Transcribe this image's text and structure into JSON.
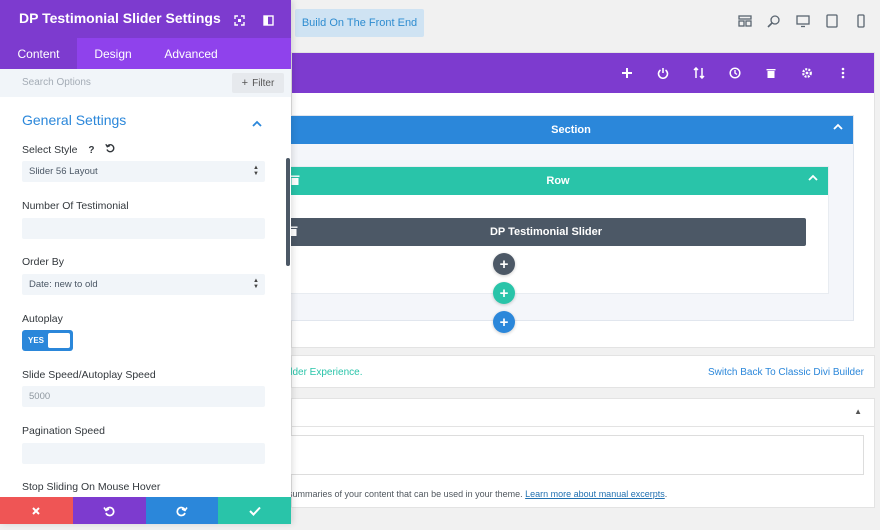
{
  "panel": {
    "title": "DP Testimonial Slider Settings",
    "tabs": [
      "Content",
      "Design",
      "Advanced"
    ],
    "search_placeholder": "Search Options",
    "filter_label": "Filter",
    "group_title": "General Settings",
    "fields": {
      "select_style": {
        "label": "Select Style",
        "value": "Slider 56 Layout"
      },
      "number_of_testimonial": {
        "label": "Number Of Testimonial",
        "value": ""
      },
      "order_by": {
        "label": "Order By",
        "value": "Date: new to old"
      },
      "autoplay": {
        "label": "Autoplay",
        "toggle_text": "YES"
      },
      "slide_speed": {
        "label": "Slide Speed/Autoplay Speed",
        "value": "5000"
      },
      "pagination_speed": {
        "label": "Pagination Speed",
        "value": ""
      },
      "stop_sliding": {
        "label": "Stop Sliding On Mouse Hover"
      }
    },
    "help_icon": "question-icon",
    "reset_icon": "reset-icon"
  },
  "topbar": {
    "front_end_button": "Build On The Front End",
    "view_icons": [
      "wireframe-icon",
      "zoom-icon",
      "desktop-icon",
      "tablet-icon",
      "phone-icon"
    ]
  },
  "builder": {
    "section_label": "Section",
    "row_label": "Row",
    "module_label": "DP Testimonial Slider"
  },
  "info": {
    "left_text": "ilder Experience.",
    "right_link": "Switch Back To Classic Divi Builder"
  },
  "excerpt": {
    "note_text": "summaries of your content that can be used in your theme.",
    "note_link": "Learn more about manual excerpts"
  },
  "colors": {
    "purple": "#7d3bcf",
    "purple_light": "#8f42ec",
    "blue": "#2b87da",
    "teal": "#29c4a9",
    "slate": "#4c5866",
    "red": "#ef5555"
  }
}
